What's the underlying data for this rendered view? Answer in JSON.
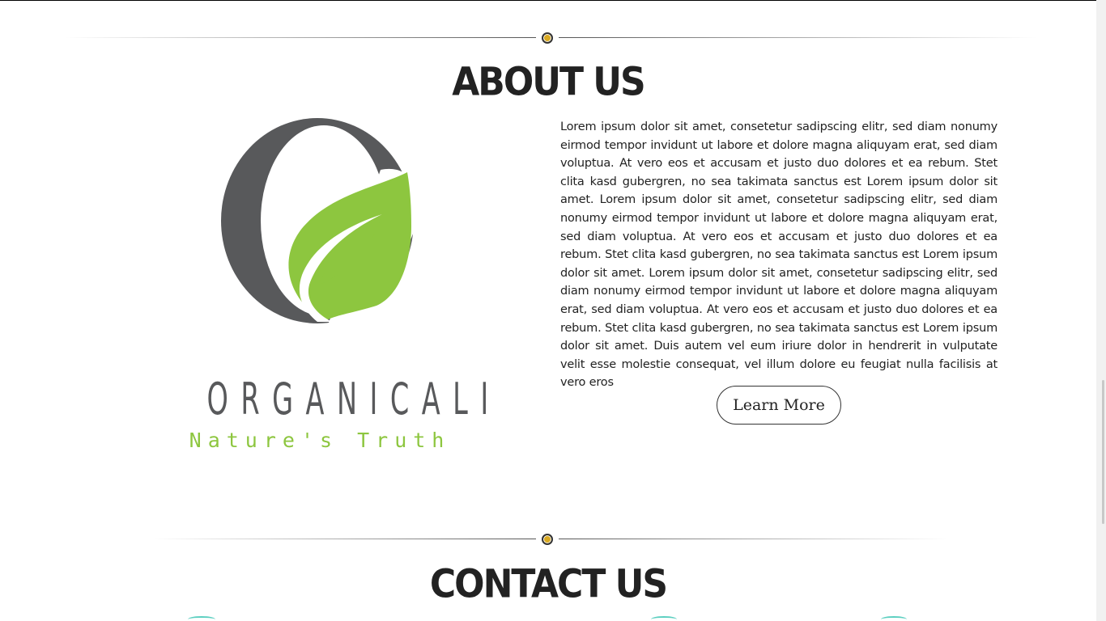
{
  "about": {
    "title": "About Us",
    "logo": {
      "name": "ORGANICALI",
      "tagline": "Nature's Truth"
    },
    "body": "Lorem ipsum dolor sit amet, consetetur sadipscing elitr, sed diam nonumy eirmod tempor invidunt ut labore et dolore magna aliquyam erat, sed diam voluptua. At vero eos et accusam et justo duo dolores et ea rebum. Stet clita kasd gubergren, no sea takimata sanctus est Lorem ipsum dolor sit amet. Lorem ipsum dolor sit amet, consetetur sadipscing elitr, sed diam nonumy eirmod tempor invidunt ut labore et dolore magna aliquyam erat, sed diam voluptua. At vero eos et accusam et justo duo dolores et ea rebum. Stet clita kasd gubergren, no sea takimata sanctus est Lorem ipsum dolor sit amet. Lorem ipsum dolor sit amet, consetetur sadipscing elitr, sed diam nonumy eirmod tempor invidunt ut labore et dolore magna aliquyam erat, sed diam voluptua. At vero eos et accusam et justo duo dolores et ea rebum. Stet clita kasd gubergren, no sea takimata sanctus est Lorem ipsum dolor sit amet. Duis autem vel eum iriure dolor in hendrerit in vulputate velit esse molestie consequat, vel illum dolore eu feugiat nulla facilisis at vero eros",
    "button_label": "Learn More"
  },
  "contact": {
    "title": "Contact Us"
  },
  "colors": {
    "logo_gray": "#58595b",
    "logo_green": "#8dc63f",
    "divider_dot": "#d9a921",
    "contact_icon_accent": "#5ccfc0",
    "text": "#222222"
  },
  "icons": {
    "divider": "divider-dot-icon",
    "logo": "leaf-o-logo-icon"
  }
}
